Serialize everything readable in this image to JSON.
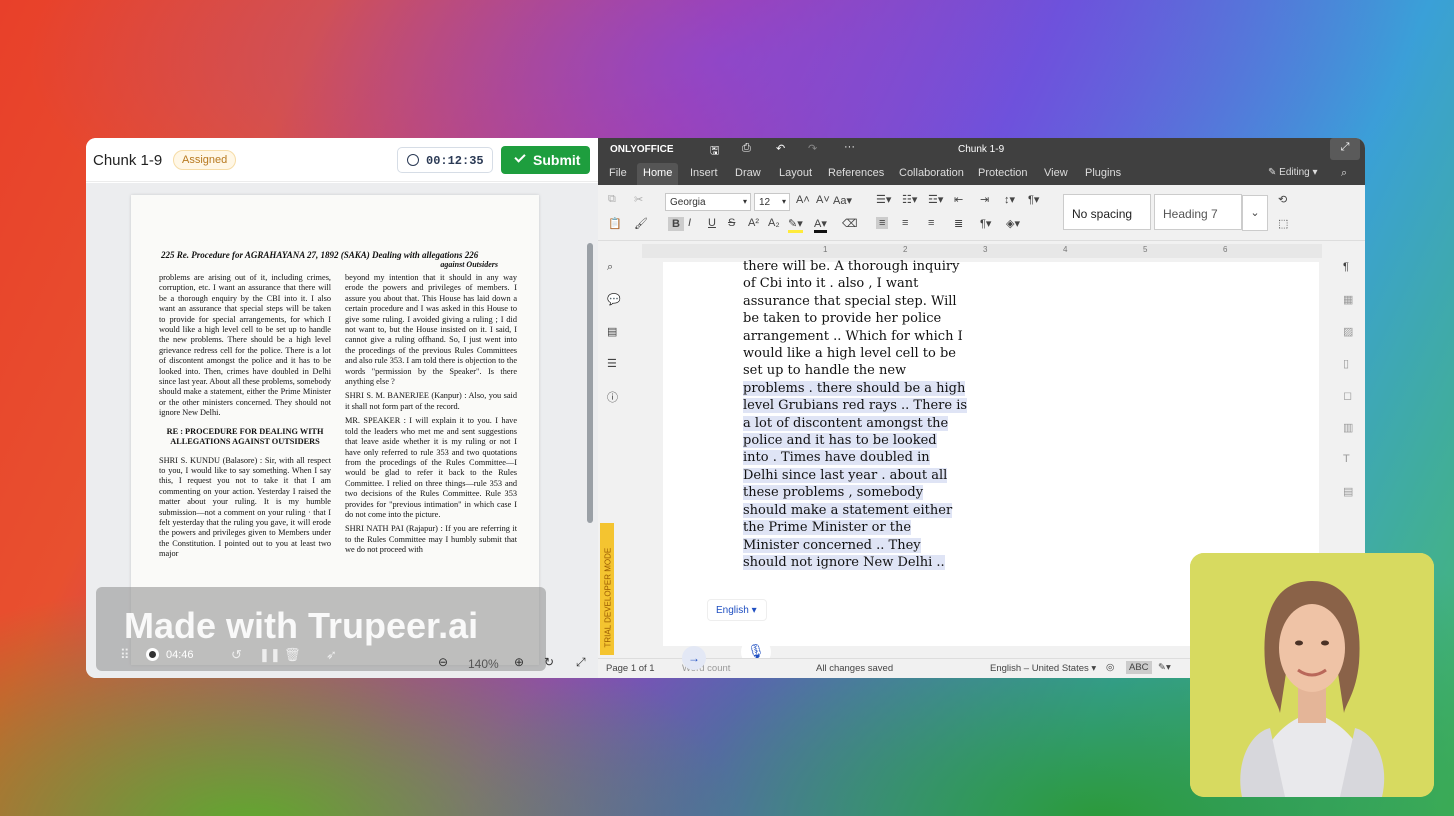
{
  "left": {
    "title": "Chunk 1-9",
    "status": "Assigned",
    "timer": "00:12:35",
    "submit": "Submit",
    "scan": {
      "header": "225  Re. Procedure for   AGRAHAYANA 27, 1892 (SAKA)   Dealing with allegations 226",
      "header2": "against Outsiders",
      "col1": [
        "problems are arising out of it, including crimes, corruption, etc. I want an assurance that there will be a thorough enquiry by the CBI into it. I also want an assurance that special steps will be taken to provide for special arrangements, for which I would like a high level cell to be set up to handle the new problems. There should be a high level grievance redress cell for the police. There is a lot of discontent amongst the police and it has to be looked into. Then, crimes have doubled in Delhi since last year. About all these problems, somebody should make a statement, either the Prime Minister or the other ministers concerned. They should not ignore New Delhi.",
        "RE : PROCEDURE FOR DEALING WITH ALLEGATIONS AGAINST OUTSIDERS",
        "SHRI S. KUNDU (Balasore) : Sir, with all respect to you, I would like to say something. When I say this, I request you not to take it that I am commenting on your action. Yesterday I raised the matter about your ruling. It is my humble submission—not a comment on your ruling · that I felt yesterday that the ruling you gave, it will erode the powers and privileges given to Members under the Constitution. I pointed out to you at least two major"
      ],
      "col2": [
        "beyond my intention that it should in any way erode the powers and privileges of members. I assure you about that. This House has laid down a certain procedure and I was asked in this House to give some ruling. I avoided giving a ruling ; I did not want to, but the House insisted on it. I said, I cannot give a ruling offhand. So, I just went into the procedings of the previous Rules Committees and also rule 353. I am told there is objection to the words \"permission by the Speaker\". Is there anything else ?",
        "SHRI S. M. BANERJEE (Kanpur) : Also, you said it shall not form part of the record.",
        "MR. SPEAKER : I will explain it to you. I have told the leaders who met me and sent suggestions that leave aside whether it is my ruling or not I have only referred to rule 353 and two quotations from the procedings of the Rules Committee—I would be glad to refer it back to the Rules Committee. I relied on three things—rule 353 and two decisions of the Rules Committee. Rule 353 provides for \"previous intimation\" in which case I do not come into the picture.",
        "SHRI NATH PAI (Rajapur) : If you are referring it to the Rules Committee may I humbly submit that we do not proceed with"
      ]
    },
    "watermark": "Made with Trupeer.ai",
    "rec_time": "04:46",
    "zoom": "140%"
  },
  "editor": {
    "app": "ONLYOFFICE",
    "doc_title": "Chunk 1-9",
    "menu": [
      "File",
      "Home",
      "Insert",
      "Draw",
      "Layout",
      "References",
      "Collaboration",
      "Protection",
      "View",
      "Plugins"
    ],
    "mode": "Editing",
    "font": "Georgia",
    "size": "12",
    "style1": "No spacing",
    "style2": "Heading 7",
    "side_label": "TRIAL DEVELOPER MODE",
    "ruler": [
      "1",
      "2",
      "3",
      "4",
      "5",
      "6"
    ],
    "text_lines": [
      "there will be. A thorough inquiry",
      "of Cbi into it . also , I want",
      "assurance that special step. Will",
      "be taken to provide her police",
      "arrangement .. Which for which I",
      "would like a high level cell to be",
      "set up to handle the new",
      "problems . there should be a high",
      "level Grubians red rays .. There is",
      "a lot of discontent amongst the",
      "police and it has to be looked",
      "into . Times have doubled in",
      "Delhi since last year . about all",
      "these problems , somebody",
      "should make a statement either",
      "the Prime Minister or the",
      "Minister concerned .. They",
      "should not ignore New Delhi .."
    ],
    "lang_pill": "English",
    "status": {
      "page": "Page 1 of 1",
      "word": "Word count",
      "saved": "All changes saved",
      "lang": "English – United States"
    }
  }
}
